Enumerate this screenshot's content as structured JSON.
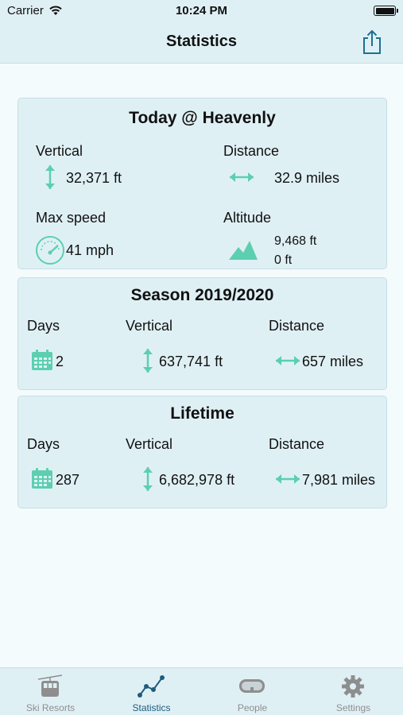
{
  "status_bar": {
    "carrier": "Carrier",
    "time": "10:24 PM"
  },
  "nav": {
    "title": "Statistics",
    "share_icon": "share-icon"
  },
  "today": {
    "title": "Today @ Heavenly",
    "vertical_label": "Vertical",
    "vertical_value": "32,371 ft",
    "distance_label": "Distance",
    "distance_value": "32.9 miles",
    "max_speed_label": "Max speed",
    "max_speed_value": "41 mph",
    "altitude_label": "Altitude",
    "altitude_max": "9,468 ft",
    "altitude_min": "0 ft"
  },
  "season": {
    "title": "Season 2019/2020",
    "days_label": "Days",
    "days_value": "2",
    "vertical_label": "Vertical",
    "vertical_value": "637,741 ft",
    "distance_label": "Distance",
    "distance_value": "657 miles"
  },
  "lifetime": {
    "title": "Lifetime",
    "days_label": "Days",
    "days_value": "287",
    "vertical_label": "Vertical",
    "vertical_value": "6,682,978 ft",
    "distance_label": "Distance",
    "distance_value": "7,981 miles"
  },
  "tabs": [
    {
      "label": "Ski Resorts",
      "icon": "gondola-icon",
      "active": false
    },
    {
      "label": "Statistics",
      "icon": "chart-icon",
      "active": true
    },
    {
      "label": "People",
      "icon": "goggles-icon",
      "active": false
    },
    {
      "label": "Settings",
      "icon": "gear-icon",
      "active": false
    }
  ],
  "colors": {
    "accent": "#5ccfb0",
    "background": "#f4fbfd",
    "bar": "#dff0f5",
    "active_tab": "#1e5d7b",
    "inactive_tab": "#8e8e8e"
  }
}
